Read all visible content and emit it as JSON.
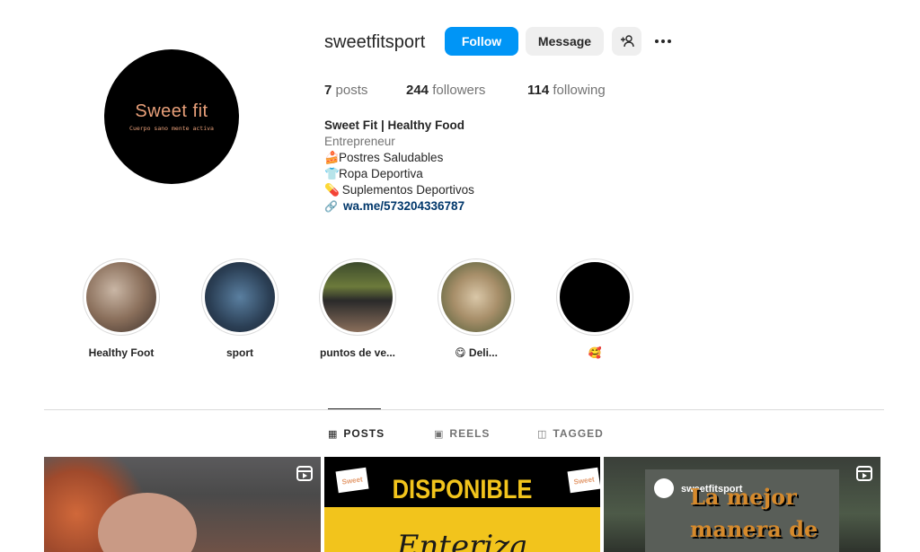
{
  "profile": {
    "username": "sweetfitsport",
    "avatar_logo": "Sweet fit",
    "avatar_tagline": "Cuerpo sano mente activa"
  },
  "actions": {
    "follow_label": "Follow",
    "message_label": "Message",
    "add_user_icon": "add-person-icon",
    "more_icon": "more-options-icon"
  },
  "stats": {
    "posts": {
      "count": "7",
      "label": "posts"
    },
    "followers": {
      "count": "244",
      "label": "followers"
    },
    "following": {
      "count": "114",
      "label": "following"
    }
  },
  "bio": {
    "name": "Sweet Fit | Healthy Food",
    "category": "Entrepreneur",
    "lines": [
      {
        "emoji": "🍰",
        "text": "Postres Saludables"
      },
      {
        "emoji": "👕",
        "text": "Ropa Deportiva"
      },
      {
        "emoji": "💊",
        "text": " Suplementos Deportivos"
      }
    ],
    "link": "wa.me/573204336787",
    "link_icon": "link-icon"
  },
  "highlights": [
    {
      "label": "Healthy Foot"
    },
    {
      "label": "sport"
    },
    {
      "label": "puntos de ve..."
    },
    {
      "label": "😋 Deli..."
    },
    {
      "label": "🥰"
    }
  ],
  "tabs": [
    {
      "label": "POSTS",
      "icon": "grid-icon",
      "active": true
    },
    {
      "label": "REELS",
      "icon": "reels-icon",
      "active": false
    },
    {
      "label": "TAGGED",
      "icon": "tagged-icon",
      "active": false
    }
  ],
  "posts": [
    {
      "type": "reel"
    },
    {
      "type": "image",
      "text_top": "DISPONIBLE",
      "text_bottom": "Enteriza",
      "badge": "Sweet"
    },
    {
      "type": "reel",
      "account": "sweetfitsport",
      "text_line1": "La mejor",
      "text_line2": "manera de",
      "badge": "Sweet"
    }
  ],
  "colors": {
    "primary_button": "#0095f6",
    "secondary_button": "#efefef",
    "link": "#00376b",
    "muted_text": "#737373",
    "avatar_logo": "#e9a07a"
  }
}
